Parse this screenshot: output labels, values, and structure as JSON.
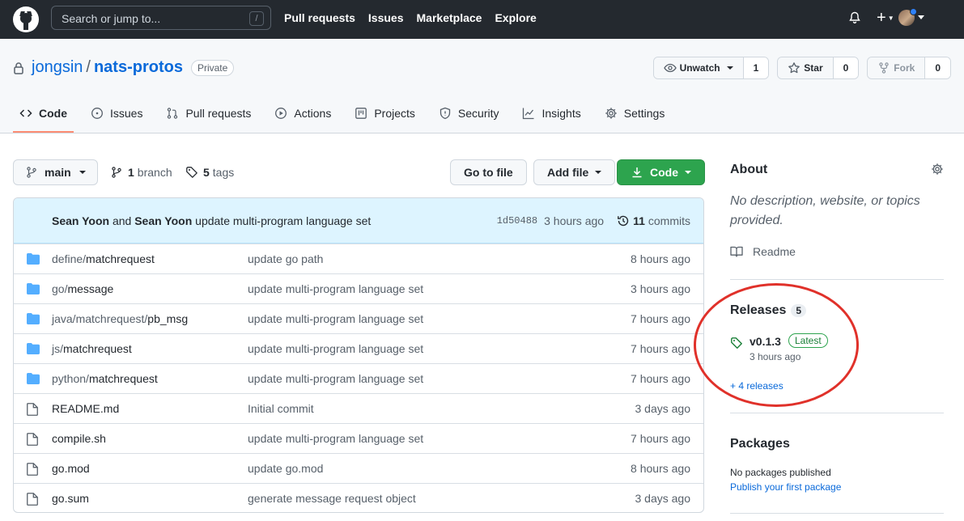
{
  "header": {
    "search_placeholder": "Search or jump to...",
    "search_shortcut": "/",
    "nav": [
      "Pull requests",
      "Issues",
      "Marketplace",
      "Explore"
    ],
    "plus": "+"
  },
  "repo": {
    "owner": "jongsin",
    "separator": "/",
    "name": "nats-protos",
    "visibility": "Private",
    "watch": {
      "label": "Unwatch",
      "count": "1"
    },
    "star": {
      "label": "Star",
      "count": "0"
    },
    "fork": {
      "label": "Fork",
      "count": "0"
    }
  },
  "tabs": [
    {
      "label": "Code",
      "icon": "code-icon",
      "active": true
    },
    {
      "label": "Issues",
      "icon": "issue-icon"
    },
    {
      "label": "Pull requests",
      "icon": "pull-request-icon"
    },
    {
      "label": "Actions",
      "icon": "play-icon"
    },
    {
      "label": "Projects",
      "icon": "project-icon"
    },
    {
      "label": "Security",
      "icon": "shield-icon"
    },
    {
      "label": "Insights",
      "icon": "graph-icon"
    },
    {
      "label": "Settings",
      "icon": "gear-icon"
    }
  ],
  "toolbar": {
    "branch": "main",
    "branch_count": "1",
    "branch_label": "branch",
    "tag_count": "5",
    "tag_label": "tags",
    "go_to_file": "Go to file",
    "add_file": "Add file",
    "code": "Code"
  },
  "commit": {
    "author1": "Sean Yoon",
    "and": "and",
    "author2": "Sean Yoon",
    "message": "update multi-program language set",
    "sha": "1d50488",
    "age": "3 hours ago",
    "count": "11",
    "count_label": "commits"
  },
  "files": [
    {
      "type": "dir",
      "dir_prefix": "define/",
      "name": "matchrequest",
      "commit": "update go path",
      "age": "8 hours ago"
    },
    {
      "type": "dir",
      "dir_prefix": "go/",
      "name": "message",
      "commit": "update multi-program language set",
      "age": "3 hours ago"
    },
    {
      "type": "dir",
      "dir_prefix": "java/matchrequest/",
      "name": "pb_msg",
      "commit": "update multi-program language set",
      "age": "7 hours ago"
    },
    {
      "type": "dir",
      "dir_prefix": "js/",
      "name": "matchrequest",
      "commit": "update multi-program language set",
      "age": "7 hours ago"
    },
    {
      "type": "dir",
      "dir_prefix": "python/",
      "name": "matchrequest",
      "commit": "update multi-program language set",
      "age": "7 hours ago"
    },
    {
      "type": "file",
      "dir_prefix": "",
      "name": "README.md",
      "commit": "Initial commit",
      "age": "3 days ago"
    },
    {
      "type": "file",
      "dir_prefix": "",
      "name": "compile.sh",
      "commit": "update multi-program language set",
      "age": "7 hours ago"
    },
    {
      "type": "file",
      "dir_prefix": "",
      "name": "go.mod",
      "commit": "update go.mod",
      "age": "8 hours ago"
    },
    {
      "type": "file",
      "dir_prefix": "",
      "name": "go.sum",
      "commit": "generate message request object",
      "age": "3 days ago"
    }
  ],
  "sidebar": {
    "about_title": "About",
    "about_desc": "No description, website, or topics provided.",
    "readme": "Readme",
    "releases_title": "Releases",
    "releases_count": "5",
    "latest_release": "v0.1.3",
    "latest_badge": "Latest",
    "latest_age": "3 hours ago",
    "more_releases": "+ 4 releases",
    "packages_title": "Packages",
    "no_packages": "No packages published",
    "publish_link": "Publish your first package"
  },
  "colors": {
    "header_bg": "#24292f",
    "link": "#0969da",
    "primary_button": "#2da44e",
    "active_tab_underline": "#fd8c73",
    "annotation": "#e0312a"
  }
}
